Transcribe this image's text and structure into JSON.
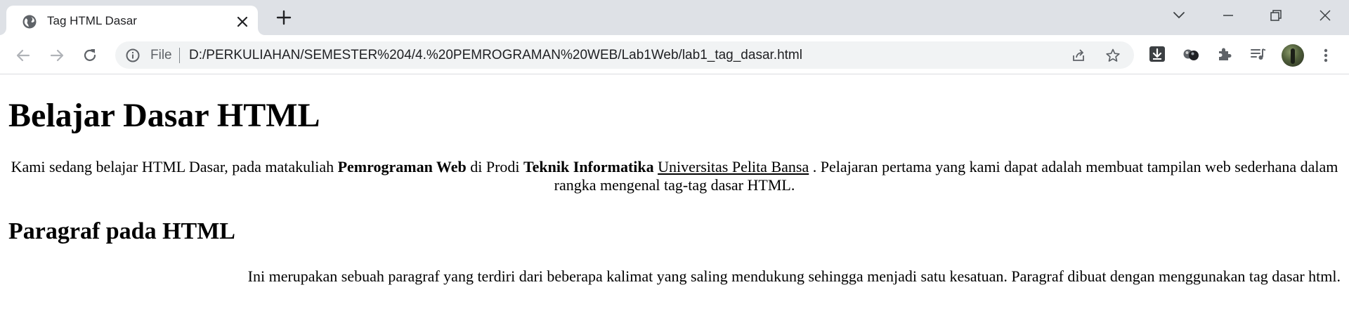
{
  "browser": {
    "tab": {
      "title": "Tag HTML Dasar",
      "favicon": "globe-icon"
    },
    "new_tab_icon": "plus-icon",
    "window_controls": [
      "chevron-down-icon",
      "minimize-icon",
      "restore-icon",
      "close-icon"
    ],
    "toolbar": {
      "back_icon": "back-arrow-icon",
      "forward_icon": "forward-arrow-icon",
      "reload_icon": "reload-icon",
      "site_info_icon": "info-icon",
      "scheme_label": "File",
      "url": "D:/PERKULIAHAN/SEMESTER%204/4.%20PEMROGRAMAN%20WEB/Lab1Web/lab1_tag_dasar.html",
      "share_icon": "share-icon",
      "bookmark_icon": "star-icon",
      "extensions": [
        "download-extension-icon",
        "spheres-extension-icon",
        "puzzle-icon",
        "media-queue-icon"
      ],
      "avatar": "profile-avatar",
      "menu_icon": "kebab-menu-icon"
    },
    "colors": {
      "tabstrip_bg": "#dee1e6",
      "omnibox_bg": "#f1f3f4",
      "icon_gray": "#5f6368"
    }
  },
  "page": {
    "heading": "Belajar Dasar HTML",
    "intro": {
      "part1": "Kami sedang belajar HTML Dasar, pada matakuliah ",
      "bold1": "Pemrograman Web",
      "part2": " di Prodi ",
      "bold2": "Teknik Informatika",
      "part3": " ",
      "underlined": "Universitas Pelita Bansa",
      "part4": " . Pelajaran pertama yang kami dapat adalah membuat tampilan web sederhana dalam rangka mengenal tag-tag dasar HTML."
    },
    "subheading": "Paragraf pada HTML",
    "paragraph": "Ini merupakan sebuah paragraf yang terdiri dari beberapa kalimat yang saling mendukung sehingga menjadi satu kesatuan. Paragraf dibuat dengan menggunakan tag dasar html."
  }
}
